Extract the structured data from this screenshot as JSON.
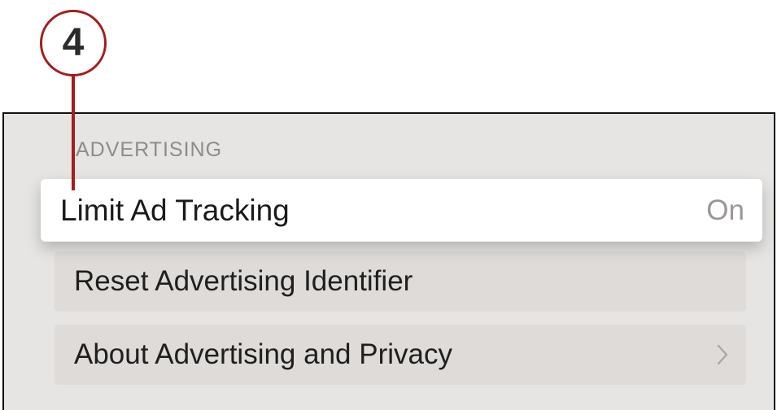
{
  "callout": {
    "number": "4"
  },
  "section": {
    "header": "ADVERTISING"
  },
  "rows": [
    {
      "label": "Limit Ad Tracking",
      "value": "On"
    },
    {
      "label": "Reset Advertising Identifier"
    },
    {
      "label": "About Advertising and Privacy",
      "icon": "chevron-right-icon"
    }
  ],
  "colors": {
    "callout": "#a61c1c",
    "panel_background": "#e7e5e3",
    "focused_row": "#ffffff",
    "row_background": "#dedbd8"
  }
}
